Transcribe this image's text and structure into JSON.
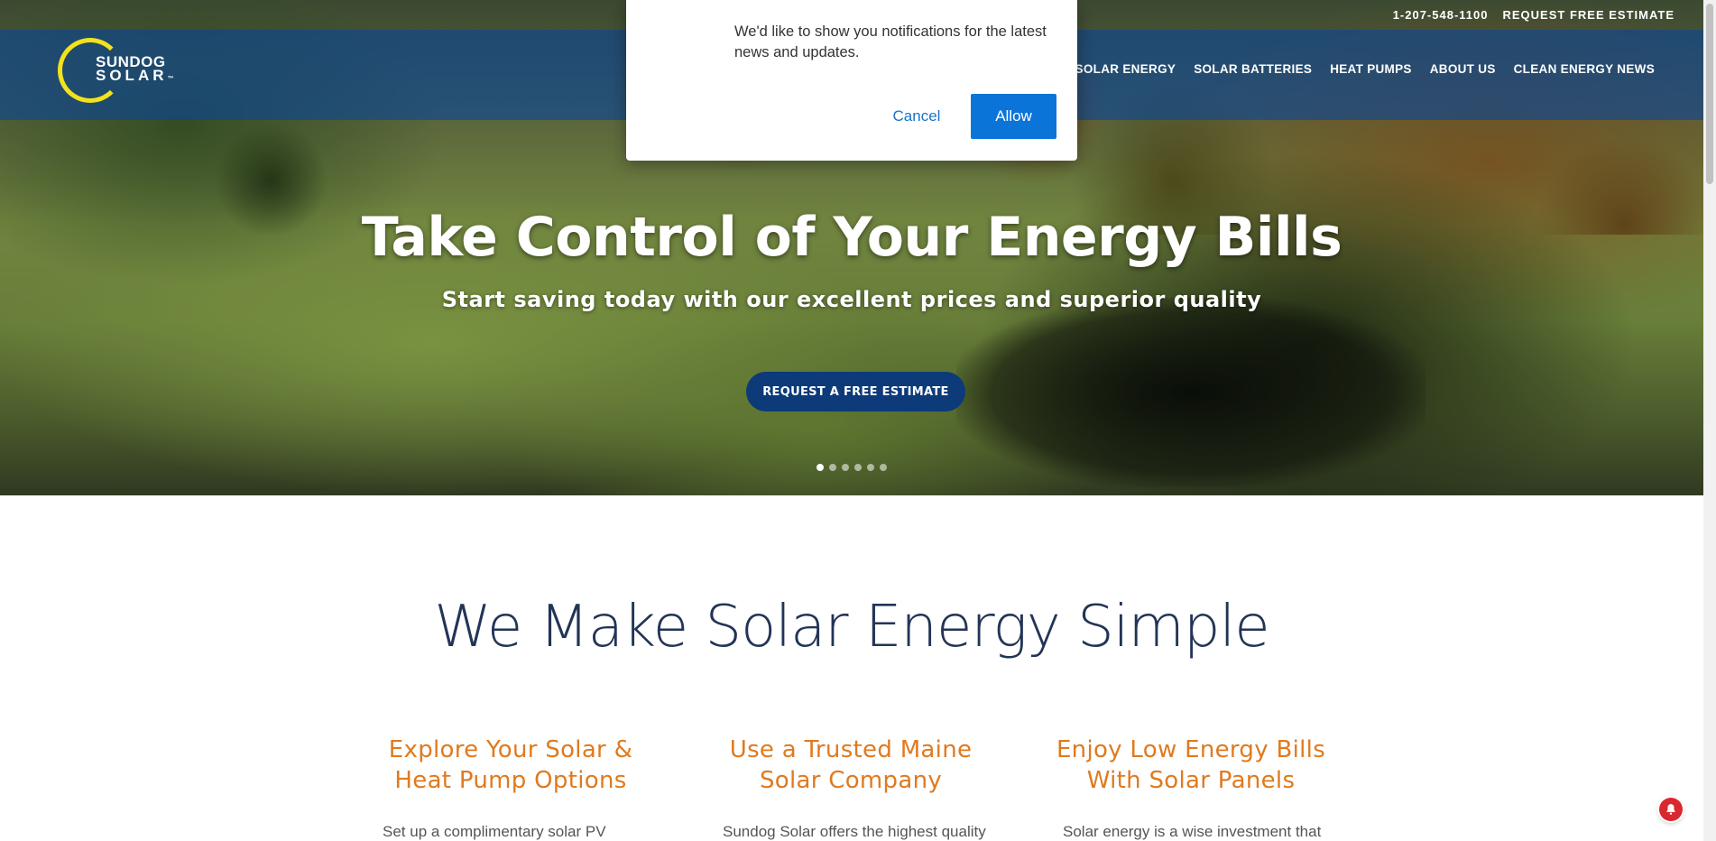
{
  "topbar": {
    "phone": "1-207-548-1100",
    "estimate_link": "REQUEST FREE ESTIMATE"
  },
  "brand": {
    "line1": "SUNDOG",
    "line2": "SOLAR",
    "tm": "™",
    "ring_color": "#f2e21b"
  },
  "nav": {
    "items": [
      {
        "label": "ERCIAL SOLAR ENERGY"
      },
      {
        "label": "SOLAR BATTERIES"
      },
      {
        "label": "HEAT PUMPS"
      },
      {
        "label": "ABOUT US"
      },
      {
        "label": "CLEAN ENERGY NEWS"
      }
    ]
  },
  "hero": {
    "title": "Take Control of Your Energy Bills",
    "subtitle": "Start saving today with our excellent prices and superior quality",
    "cta": "REQUEST A FREE ESTIMATE",
    "slides": 6,
    "active_slide": 1
  },
  "popup": {
    "message": "We'd like to show you notifications for the latest news and updates.",
    "cancel": "Cancel",
    "allow": "Allow"
  },
  "main": {
    "headline": "We Make Solar Energy Simple",
    "columns": [
      {
        "title_line1": "Explore Your Solar &",
        "title_line2": "Heat Pump Options",
        "body": "Set up a complimentary solar PV"
      },
      {
        "title_line1": "Use a Trusted Maine",
        "title_line2": "Solar Company",
        "body": "Sundog Solar offers the highest quality"
      },
      {
        "title_line1": "Enjoy Low Energy Bills",
        "title_line2": "With Solar Panels",
        "body": "Solar energy is a wise investment that"
      }
    ]
  },
  "colors": {
    "navy": "#233457",
    "orange": "#e07a1f",
    "cta_blue": "#0d3a78",
    "allow_blue": "#0a74d8",
    "bell_red": "#d9282f"
  },
  "icons": {
    "bell": "notification-bell-icon"
  }
}
